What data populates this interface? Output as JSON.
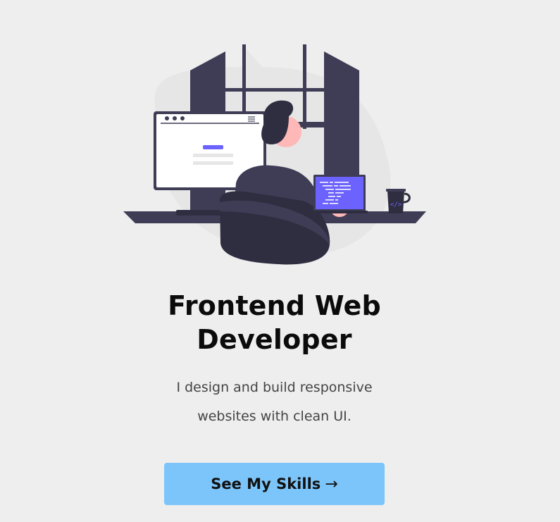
{
  "hero": {
    "title_line1": "Frontend Web",
    "title_line2": "Developer",
    "subtitle_line1": "I design and build responsive",
    "subtitle_line2": "websites with clean UI.",
    "cta_label": "See My Skills",
    "cta_arrow": "→",
    "illustration_icon": "developer-at-desk-illustration"
  },
  "colors": {
    "background": "#eeeeee",
    "dark": "#3f3d56",
    "accent": "#6c63ff",
    "button": "#7cc5fb",
    "skin": "#ffb8b8"
  }
}
